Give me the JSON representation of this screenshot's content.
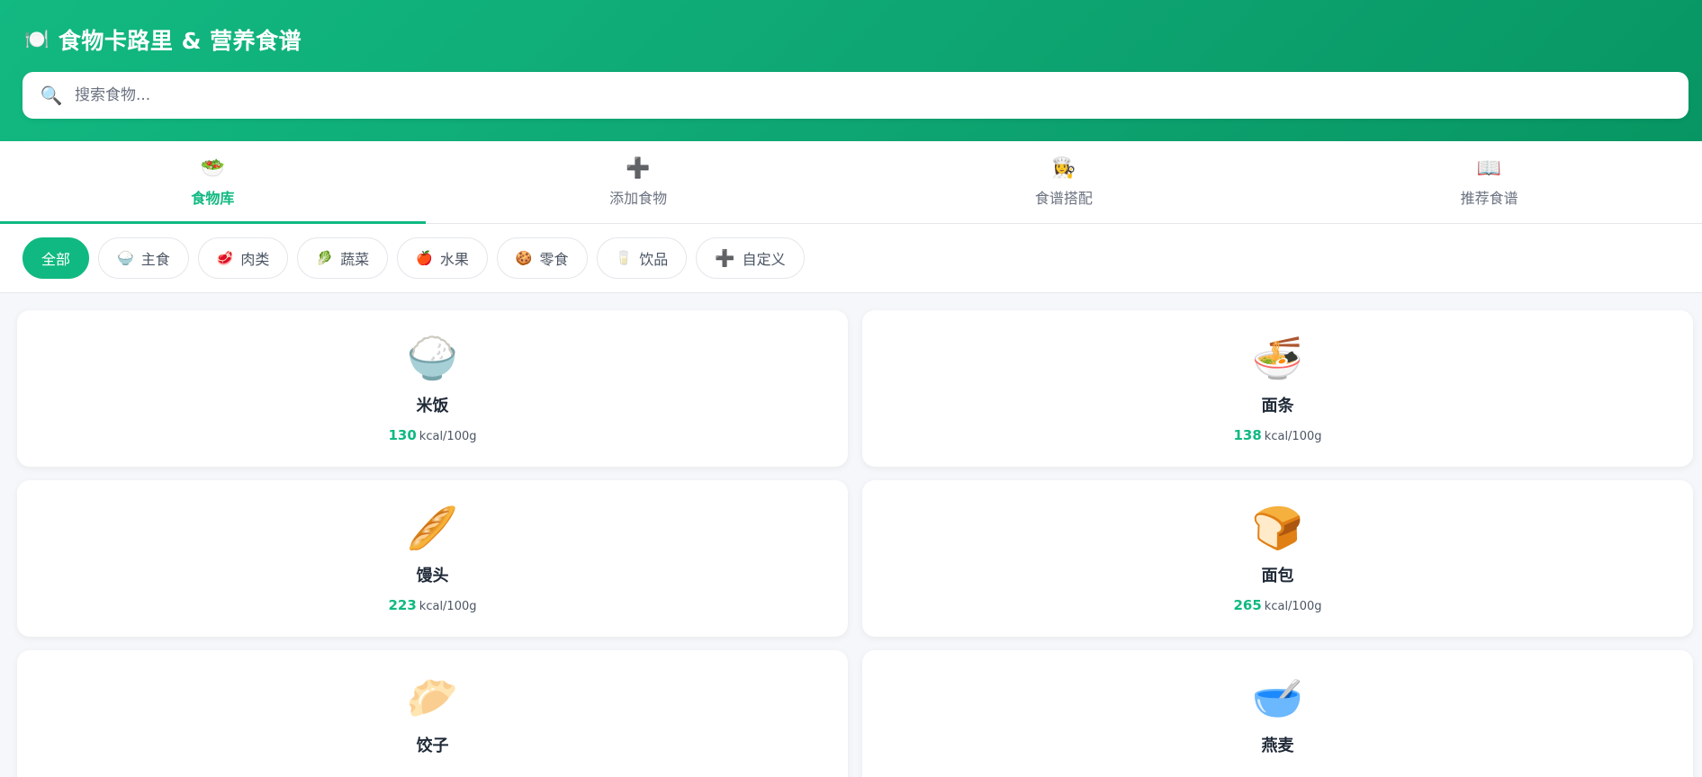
{
  "header": {
    "logo_icon": "plate-icon",
    "logo_glyph": "🍽️",
    "title": "食物卡路里 & 营养食谱",
    "search": {
      "icon_glyph": "🔍",
      "placeholder": "搜索食物...",
      "value": ""
    }
  },
  "tabs": [
    {
      "icon": "salad-icon",
      "glyph": "🥗",
      "label": "食物库",
      "active": true
    },
    {
      "icon": "plus-icon",
      "glyph": "➕",
      "label": "添加食物",
      "active": false
    },
    {
      "icon": "cook-icon",
      "glyph": "👩‍🍳",
      "label": "食谱搭配",
      "active": false
    },
    {
      "icon": "book-icon",
      "glyph": "📖",
      "label": "推荐食谱",
      "active": false
    }
  ],
  "categories": [
    {
      "icon": "",
      "glyph": "",
      "label": "全部",
      "active": true
    },
    {
      "icon": "rice-icon",
      "glyph": "🍚",
      "label": "主食",
      "active": false
    },
    {
      "icon": "meat-icon",
      "glyph": "🥩",
      "label": "肉类",
      "active": false
    },
    {
      "icon": "vegetable-icon",
      "glyph": "🥬",
      "label": "蔬菜",
      "active": false
    },
    {
      "icon": "apple-icon",
      "glyph": "🍎",
      "label": "水果",
      "active": false
    },
    {
      "icon": "cookie-icon",
      "glyph": "🍪",
      "label": "零食",
      "active": false
    },
    {
      "icon": "cup-icon",
      "glyph": "🥛",
      "label": "饮品",
      "active": false
    },
    {
      "icon": "plus-icon",
      "glyph": "➕",
      "label": "自定义",
      "active": false
    }
  ],
  "foods": [
    {
      "icon": "rice-bowl-icon",
      "glyph": "🍚",
      "name": "米饭",
      "kcal": "130",
      "unit": "kcal/100g"
    },
    {
      "icon": "noodles-icon",
      "glyph": "🍜",
      "name": "面条",
      "kcal": "138",
      "unit": "kcal/100g"
    },
    {
      "icon": "bread-roll-icon",
      "glyph": "🥖",
      "name": "馒头",
      "kcal": "223",
      "unit": "kcal/100g"
    },
    {
      "icon": "bread-icon",
      "glyph": "🍞",
      "name": "面包",
      "kcal": "265",
      "unit": "kcal/100g"
    },
    {
      "icon": "dumpling-icon",
      "glyph": "🥟",
      "name": "饺子",
      "kcal": "",
      "unit": ""
    },
    {
      "icon": "oatmeal-icon",
      "glyph": "🥣",
      "name": "燕麦",
      "kcal": "",
      "unit": ""
    }
  ],
  "colors": {
    "accent": "#10b981",
    "header_gradient_start": "#12b981",
    "header_gradient_end": "#079663",
    "icon_purple": "#7c5cc4"
  }
}
